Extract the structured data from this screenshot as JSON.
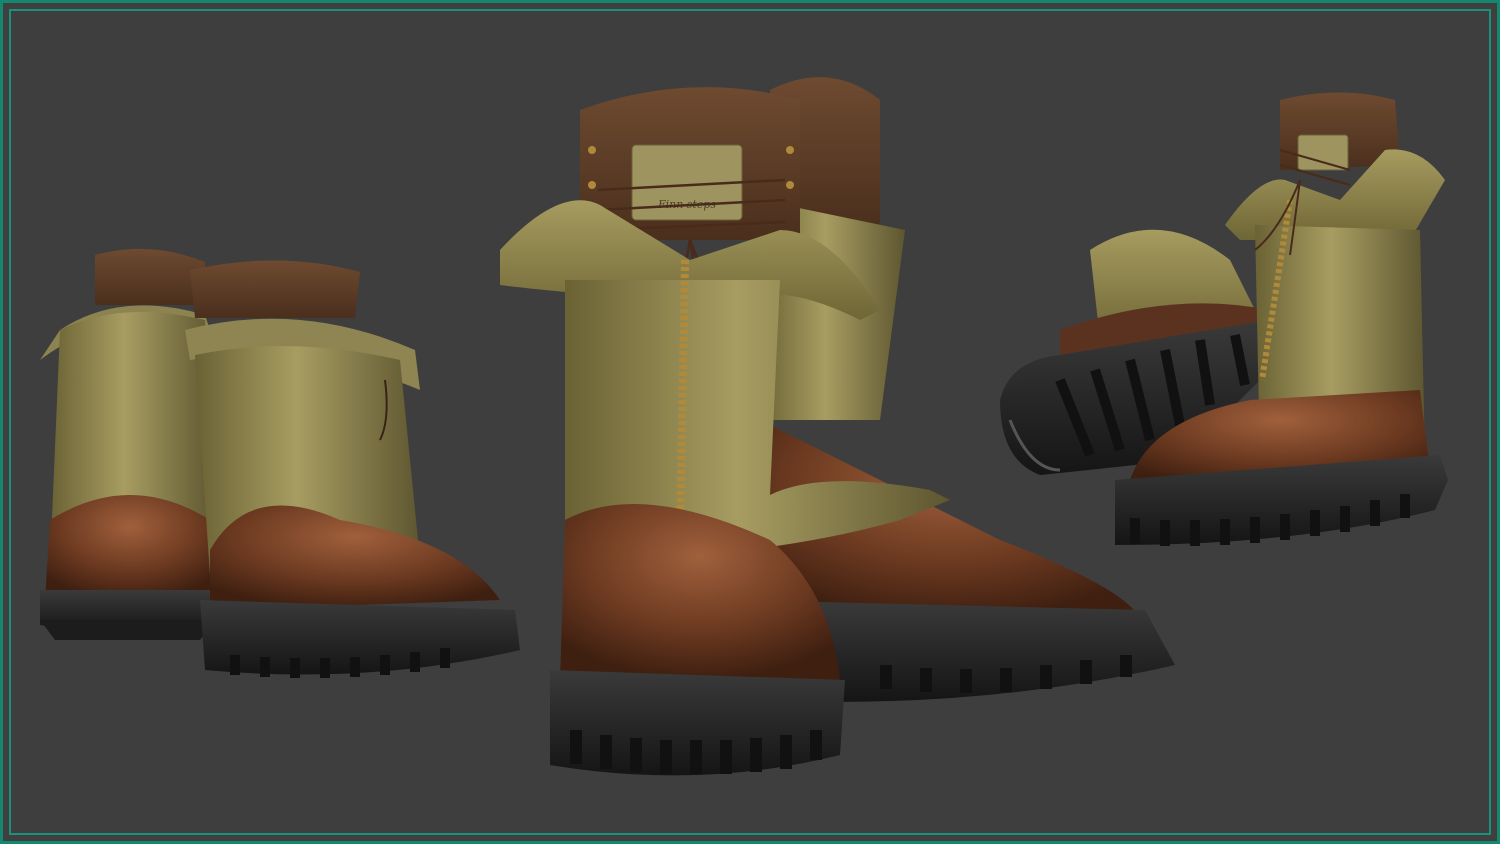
{
  "scene": {
    "background": "#3e3e3e",
    "border_color": "#1a9179",
    "description_colors": {
      "olive_leather": "#8a8148",
      "olive_highlight": "#b3a870",
      "brown_leather": "#6a3a22",
      "brown_highlight": "#9a5a38",
      "suede_cuff": "#5a3b26",
      "sole": "#262626",
      "zipper": "#b08a3a",
      "lace": "#4a2a1a"
    }
  },
  "label_tag": {
    "text": "Finn steps"
  },
  "views": {
    "left": "boots-back-view",
    "center": "boots-front-view",
    "right": "boots-side-sole-view"
  }
}
